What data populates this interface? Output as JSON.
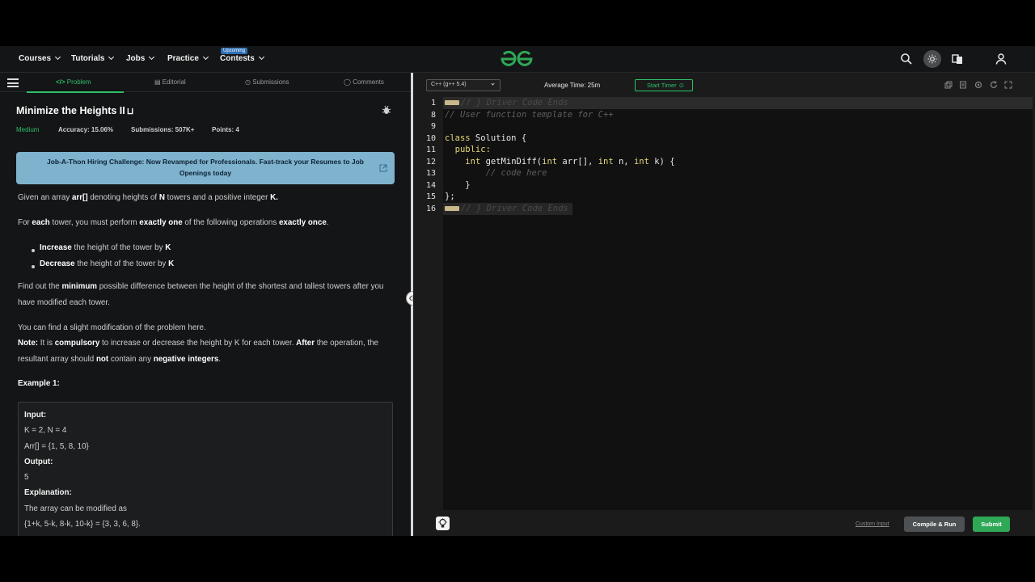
{
  "nav": {
    "items": [
      {
        "label": "Courses"
      },
      {
        "label": "Tutorials"
      },
      {
        "label": "Jobs"
      },
      {
        "label": "Practice"
      },
      {
        "label": "Contests",
        "badge": "Upcoming"
      }
    ],
    "logo_icon": "gfg-logo-icon",
    "icons": [
      "search-icon",
      "theme-toggle-icon",
      "translate-icon",
      "user-icon"
    ]
  },
  "tabs": [
    {
      "label": "Problem",
      "active": true,
      "icon": "code-icon"
    },
    {
      "label": "Editorial",
      "icon": "document-icon"
    },
    {
      "label": "Submissions",
      "icon": "clock-icon"
    },
    {
      "label": "Comments",
      "icon": "comment-icon"
    }
  ],
  "problem": {
    "title": "Minimize the Heights II",
    "difficulty": "Medium",
    "accuracy": "Accuracy: 15.06%",
    "submissions": "Submissions: 507K+",
    "points": "Points: 4",
    "banner": "Job-A-Thon Hiring Challenge: Now Revamped for Professionals. Fast-track your Resumes to Job Openings today",
    "desc": {
      "p1_a": "Given an array ",
      "p1_b": "arr[]",
      "p1_c": " denoting heights of ",
      "p1_d": "N",
      "p1_e": " towers and a positive integer ",
      "p1_f": "K.",
      "p2_a": "For ",
      "p2_b": "each",
      "p2_c": " tower, you must perform ",
      "p2_d": "exactly one",
      "p2_e": " of the following operations ",
      "p2_f": "exactly once",
      "p2_g": ".",
      "b1_a": "Increase",
      "b1_b": " the height of the tower by ",
      "b1_c": "K",
      "b2_a": "Decrease",
      "b2_b": " the height of the tower by ",
      "b2_c": "K",
      "p3_a": "Find out the ",
      "p3_b": "minimum",
      "p3_c": " possible difference between the height of the shortest and tallest towers after you have modified each tower.",
      "p4": "You can find a slight modification of the problem here.",
      "p5_a": "Note:",
      "p5_b": " It is ",
      "p5_c": "compulsory",
      "p5_d": " to increase or decrease the height by K for each tower. ",
      "p5_e": "After",
      "p5_f": " the operation, the resultant array should ",
      "p5_g": "not",
      "p5_h": " contain any ",
      "p5_i": "negative integers",
      "p5_j": ".",
      "example_title": "Example 1:"
    },
    "example": {
      "input_label": "Input:",
      "input_l1": "K = 2, N = 4",
      "input_l2": "Arr[] = {1, 5, 8, 10}",
      "output_label": "Output:",
      "output_value": "5",
      "explanation_label": "Explanation:",
      "exp_l1": "The array can be modified as",
      "exp_l2": "{1+k, 5-k, 8-k, 10-k} = {3, 3, 6, 8}."
    }
  },
  "editor": {
    "language": "C++ (g++ 5.4)",
    "avg_time": "Average Time: 25m",
    "start_timer": "Start Timer",
    "line_numbers": [
      "1",
      "8",
      "9",
      "10",
      "11",
      "12",
      "13",
      "14",
      "15",
      "16"
    ],
    "code": {
      "l1": "// } Driver Code Ends",
      "l8": "// User function template for C++",
      "l10_kw": "class",
      "l10_rest": " Solution {",
      "l11": "  public:",
      "l12_a": "    ",
      "l12_kw1": "int",
      "l12_b": " getMinDiff(",
      "l12_kw2": "int",
      "l12_c": " arr[], ",
      "l12_kw3": "int",
      "l12_d": " n, ",
      "l12_kw4": "int",
      "l12_e": " k) {",
      "l13": "        // code here",
      "l14": "    }",
      "l15": "};",
      "l16": "// } Driver Code Ends"
    },
    "custom_input": "Custom Input",
    "compile_run": "Compile & Run",
    "submit": "Submit"
  }
}
